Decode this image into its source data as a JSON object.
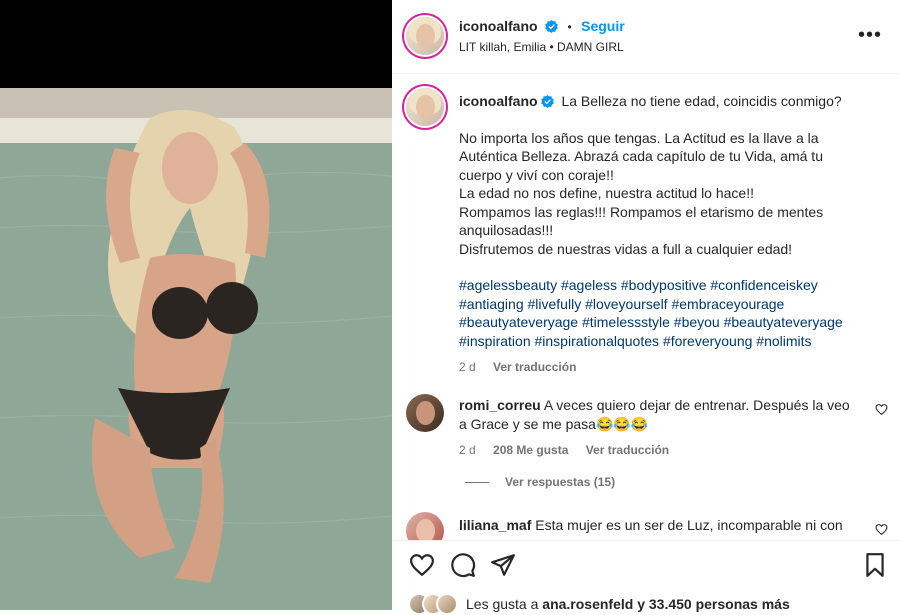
{
  "post": {
    "username": "iconoalfano",
    "follow_label": "Seguir",
    "separator": "•",
    "music": "LIT killah, Emilia • DAMN GIRL",
    "more": "•••"
  },
  "caption": {
    "username": "iconoalfano",
    "lines": [
      "La Belleza no tiene edad, coincidis conmigo?",
      "No importa los años que tengas. La Actitud es la llave a la",
      "Auténtica Belleza. Abrazá cada capítulo de tu Vida, amá tu",
      "cuerpo y viví con coraje!!",
      "La edad no nos define, nuestra actitud lo hace!!",
      "Rompamos las reglas!!! Rompamos el etarismo de mentes",
      "anquilosadas!!!",
      "Disfrutemos de nuestras vidas a full a cualquier edad!"
    ],
    "hashtag_lines": [
      "#agelessbeauty #ageless #bodypositive #confidenceiskey",
      "#antiaging #livefully #loveyourself #embraceyourage",
      "#beautyateveryage #timelessstyle #beyou #beautyateveryage",
      "#inspiration #inspirationalquotes #foreveryoung #nolimits"
    ],
    "age": "2 d",
    "translate": "Ver traducción"
  },
  "comments": [
    {
      "username": "romi_correu",
      "line1": "A veces quiero dejar de entrenar. Después la veo",
      "line2": "a Grace y se me pasa😂😂😂",
      "age": "2 d",
      "likes": "208 Me gusta",
      "translate": "Ver traducción",
      "replies": "Ver respuestas (15)"
    },
    {
      "username": "liliana_maf",
      "line1": "Esta mujer es un ser de Luz, incomparable ni con"
    }
  ],
  "footer": {
    "likes_prefix": "Les gusta a",
    "likes_user": "ana.rosenfeld",
    "likes_suffix": "y 33.450 personas más"
  },
  "colors": {
    "accent": "#0095f6",
    "hashtag": "#00376b",
    "muted": "#737373",
    "text": "#262626",
    "verified": "#0095f6"
  },
  "icons": [
    "verified-icon",
    "more-icon",
    "heart-icon",
    "comment-icon",
    "share-icon",
    "bookmark-icon",
    "heart-small-icon"
  ]
}
